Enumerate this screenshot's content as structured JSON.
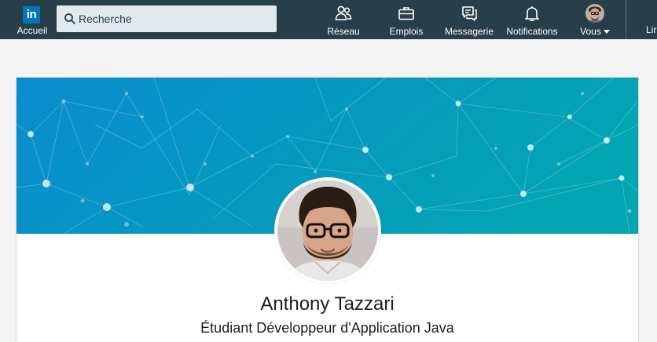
{
  "topbar": {
    "logo_text": "in",
    "home_label": "Accueil",
    "search_placeholder": "Recherche",
    "nav": {
      "network": "Réseau",
      "jobs": "Emplois",
      "messaging": "Messagerie",
      "notifications": "Notifications",
      "me": "Vous"
    },
    "cut_label": "Lir"
  },
  "profile": {
    "name": "Anthony Tazzari",
    "headline": "Étudiant Développeur d'Application Java"
  },
  "colors": {
    "topbar_bg": "#283e4a",
    "brand": "#0077b5",
    "banner_start": "#0a8ccf",
    "banner_end": "#03a4b4"
  },
  "icons": [
    "linkedin-logo-icon",
    "search-icon",
    "network-icon",
    "briefcase-icon",
    "messaging-icon",
    "bell-icon",
    "avatar"
  ]
}
